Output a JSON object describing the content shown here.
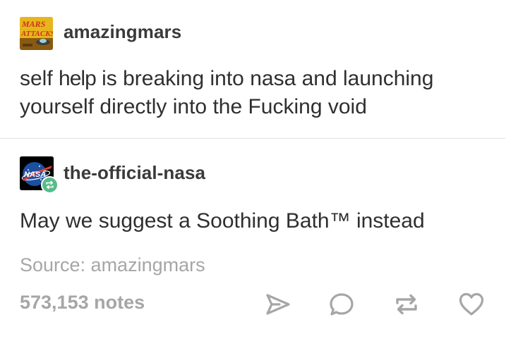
{
  "posts": [
    {
      "username": "amazingmars",
      "avatar_icon": "mars-attacks-avatar",
      "avatar_text": "MARS ATTACKS",
      "body_before": "self ",
      "body_emph": "help",
      "body_after": " is breaking into nasa and launching yourself directly into the Fucking void"
    },
    {
      "username": "the-official-nasa",
      "avatar_icon": "nasa-meatball-avatar",
      "avatar_text": "NASA",
      "badge_icon": "reblog-badge-icon",
      "body": "May we suggest a Soothing Bath™ instead"
    }
  ],
  "source": {
    "text": "Source: amazingmars"
  },
  "footer": {
    "notes": "573,153 notes",
    "actions": [
      {
        "name": "share",
        "icon": "paper-plane-icon"
      },
      {
        "name": "reply",
        "icon": "speech-bubble-icon"
      },
      {
        "name": "reblog",
        "icon": "reblog-arrows-icon"
      },
      {
        "name": "like",
        "icon": "heart-icon"
      }
    ]
  },
  "colors": {
    "text": "#333333",
    "muted": "#a6a6a6",
    "divider": "#e3e3e3",
    "reblog_green": "#56bc8a",
    "mars_yellow": "#e8b51c",
    "mars_red": "#c8341e",
    "nasa_blue": "#1d4fa0",
    "nasa_red": "#e03c31"
  }
}
